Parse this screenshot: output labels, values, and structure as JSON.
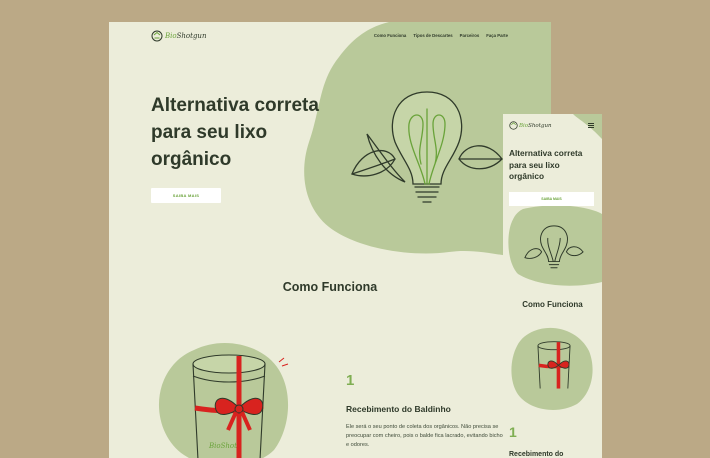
{
  "brand": {
    "name_a": "Bio",
    "name_b": "Shot",
    "name_c": "gun"
  },
  "nav": {
    "links": [
      "Como Funciona",
      "Tipos de Descartes",
      "Parceiros",
      "Faça Parte"
    ]
  },
  "hero": {
    "title": "Alternativa correta para seu lixo orgânico",
    "button": "SAIBA MAIS"
  },
  "how_it_works": {
    "title": "Como Funciona",
    "step_number": "1",
    "step_title": "Recebimento do Baldinho",
    "step_desc": "Ele será o seu ponto de coleta dos orgânicos. Não precisa se preocupar com cheiro, pois o balde fica lacrado, evitando bichos e odores."
  },
  "bucket_label": "BioShot",
  "mobile": {
    "hero_title": "Alternativa correta para seu lixo orgânico",
    "button": "SAIBA MAIS",
    "section_title": "Como Funciona",
    "step_number": "1",
    "step_title": "Recebimento do"
  },
  "colors": {
    "background": "#bba986",
    "page": "#ecedda",
    "blob": "#b9c99a",
    "accent": "#6aa33a",
    "text": "#2f3a2a",
    "ribbon": "#d8231f"
  },
  "icons": [
    "recycle-logo-icon",
    "lightbulb-leaves-illustration",
    "bucket-gift-illustration",
    "hamburger-menu-icon"
  ]
}
